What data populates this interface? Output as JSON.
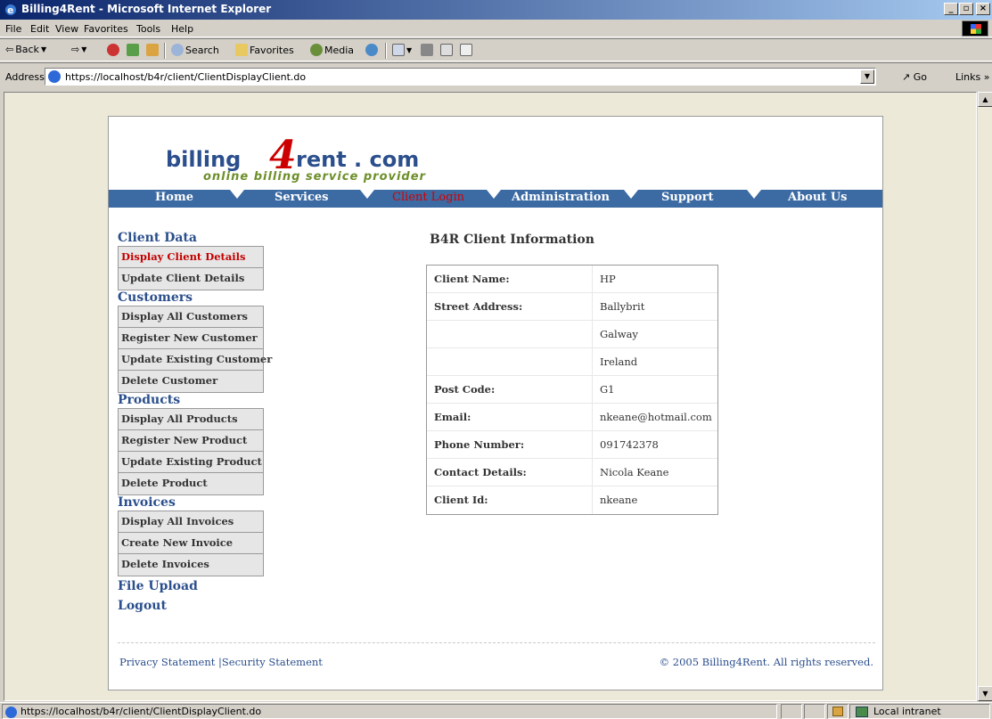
{
  "window": {
    "title": "Billing4Rent - Microsoft Internet Explorer"
  },
  "menu": {
    "items": [
      "File",
      "Edit",
      "View",
      "Favorites",
      "Tools",
      "Help"
    ]
  },
  "toolbar": {
    "back": "Back",
    "search": "Search",
    "favorites": "Favorites",
    "media": "Media"
  },
  "address": {
    "label": "Address",
    "url": "https://localhost/b4r/client/ClientDisplayClient.do",
    "go": "Go",
    "links": "Links"
  },
  "logo": {
    "word1": "billing",
    "digit": "4",
    "word2": "rent . com",
    "tagline": "online billing service provider"
  },
  "nav": {
    "items": [
      "Home",
      "Services",
      "Client Login",
      "Administration",
      "Support",
      "About Us"
    ],
    "active": "Client Login"
  },
  "sidebar": {
    "client_data": {
      "title": "Client Data",
      "items": [
        "Display Client Details",
        "Update Client Details"
      ]
    },
    "customers": {
      "title": "Customers",
      "items": [
        "Display All Customers",
        "Register New Customer",
        "Update Existing Customer",
        "Delete Customer"
      ]
    },
    "products": {
      "title": "Products",
      "items": [
        "Display All Products",
        "Register New Product",
        "Update Existing Product",
        "Delete Product"
      ]
    },
    "invoices": {
      "title": "Invoices",
      "items": [
        "Display All Invoices",
        "Create New Invoice",
        "Delete Invoices"
      ]
    },
    "file_upload": "File Upload",
    "logout": "Logout"
  },
  "main": {
    "heading": "B4R Client Information",
    "rows": [
      {
        "label": "Client Name:",
        "value": "HP"
      },
      {
        "label": "Street Address:",
        "value": "Ballybrit"
      },
      {
        "label": "",
        "value": "Galway"
      },
      {
        "label": "",
        "value": "Ireland"
      },
      {
        "label": "Post Code:",
        "value": "G1"
      },
      {
        "label": "Email:",
        "value": "nkeane@hotmail.com"
      },
      {
        "label": "Phone Number:",
        "value": "091742378"
      },
      {
        "label": "Contact Details:",
        "value": "Nicola Keane"
      },
      {
        "label": "Client Id:",
        "value": "nkeane"
      }
    ]
  },
  "footer": {
    "privacy": "Privacy Statement",
    "divider": "|",
    "security": "Security Statement",
    "copyright": "© 2005 Billing4Rent. All rights reserved."
  },
  "status": {
    "text": "https://localhost/b4r/client/ClientDisplayClient.do",
    "zone": "Local intranet"
  },
  "colors": {
    "nav_bg": "#3c6aa3",
    "brand_blue": "#2b4f8c",
    "active_red": "#c40000",
    "tagline_green": "#6d8f2a"
  }
}
